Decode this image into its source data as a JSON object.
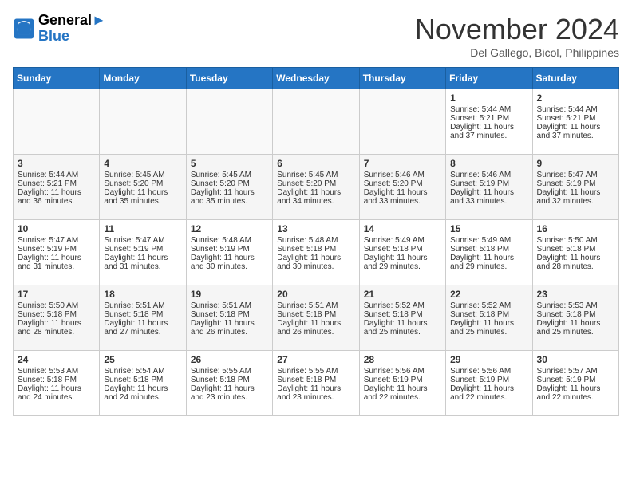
{
  "header": {
    "logo_line1": "General",
    "logo_line2": "Blue",
    "month": "November 2024",
    "location": "Del Gallego, Bicol, Philippines"
  },
  "weekdays": [
    "Sunday",
    "Monday",
    "Tuesday",
    "Wednesday",
    "Thursday",
    "Friday",
    "Saturday"
  ],
  "weeks": [
    [
      {
        "day": "",
        "info": ""
      },
      {
        "day": "",
        "info": ""
      },
      {
        "day": "",
        "info": ""
      },
      {
        "day": "",
        "info": ""
      },
      {
        "day": "",
        "info": ""
      },
      {
        "day": "1",
        "info": "Sunrise: 5:44 AM\nSunset: 5:21 PM\nDaylight: 11 hours\nand 37 minutes."
      },
      {
        "day": "2",
        "info": "Sunrise: 5:44 AM\nSunset: 5:21 PM\nDaylight: 11 hours\nand 37 minutes."
      }
    ],
    [
      {
        "day": "3",
        "info": "Sunrise: 5:44 AM\nSunset: 5:21 PM\nDaylight: 11 hours\nand 36 minutes."
      },
      {
        "day": "4",
        "info": "Sunrise: 5:45 AM\nSunset: 5:20 PM\nDaylight: 11 hours\nand 35 minutes."
      },
      {
        "day": "5",
        "info": "Sunrise: 5:45 AM\nSunset: 5:20 PM\nDaylight: 11 hours\nand 35 minutes."
      },
      {
        "day": "6",
        "info": "Sunrise: 5:45 AM\nSunset: 5:20 PM\nDaylight: 11 hours\nand 34 minutes."
      },
      {
        "day": "7",
        "info": "Sunrise: 5:46 AM\nSunset: 5:20 PM\nDaylight: 11 hours\nand 33 minutes."
      },
      {
        "day": "8",
        "info": "Sunrise: 5:46 AM\nSunset: 5:19 PM\nDaylight: 11 hours\nand 33 minutes."
      },
      {
        "day": "9",
        "info": "Sunrise: 5:47 AM\nSunset: 5:19 PM\nDaylight: 11 hours\nand 32 minutes."
      }
    ],
    [
      {
        "day": "10",
        "info": "Sunrise: 5:47 AM\nSunset: 5:19 PM\nDaylight: 11 hours\nand 31 minutes."
      },
      {
        "day": "11",
        "info": "Sunrise: 5:47 AM\nSunset: 5:19 PM\nDaylight: 11 hours\nand 31 minutes."
      },
      {
        "day": "12",
        "info": "Sunrise: 5:48 AM\nSunset: 5:19 PM\nDaylight: 11 hours\nand 30 minutes."
      },
      {
        "day": "13",
        "info": "Sunrise: 5:48 AM\nSunset: 5:18 PM\nDaylight: 11 hours\nand 30 minutes."
      },
      {
        "day": "14",
        "info": "Sunrise: 5:49 AM\nSunset: 5:18 PM\nDaylight: 11 hours\nand 29 minutes."
      },
      {
        "day": "15",
        "info": "Sunrise: 5:49 AM\nSunset: 5:18 PM\nDaylight: 11 hours\nand 29 minutes."
      },
      {
        "day": "16",
        "info": "Sunrise: 5:50 AM\nSunset: 5:18 PM\nDaylight: 11 hours\nand 28 minutes."
      }
    ],
    [
      {
        "day": "17",
        "info": "Sunrise: 5:50 AM\nSunset: 5:18 PM\nDaylight: 11 hours\nand 28 minutes."
      },
      {
        "day": "18",
        "info": "Sunrise: 5:51 AM\nSunset: 5:18 PM\nDaylight: 11 hours\nand 27 minutes."
      },
      {
        "day": "19",
        "info": "Sunrise: 5:51 AM\nSunset: 5:18 PM\nDaylight: 11 hours\nand 26 minutes."
      },
      {
        "day": "20",
        "info": "Sunrise: 5:51 AM\nSunset: 5:18 PM\nDaylight: 11 hours\nand 26 minutes."
      },
      {
        "day": "21",
        "info": "Sunrise: 5:52 AM\nSunset: 5:18 PM\nDaylight: 11 hours\nand 25 minutes."
      },
      {
        "day": "22",
        "info": "Sunrise: 5:52 AM\nSunset: 5:18 PM\nDaylight: 11 hours\nand 25 minutes."
      },
      {
        "day": "23",
        "info": "Sunrise: 5:53 AM\nSunset: 5:18 PM\nDaylight: 11 hours\nand 25 minutes."
      }
    ],
    [
      {
        "day": "24",
        "info": "Sunrise: 5:53 AM\nSunset: 5:18 PM\nDaylight: 11 hours\nand 24 minutes."
      },
      {
        "day": "25",
        "info": "Sunrise: 5:54 AM\nSunset: 5:18 PM\nDaylight: 11 hours\nand 24 minutes."
      },
      {
        "day": "26",
        "info": "Sunrise: 5:55 AM\nSunset: 5:18 PM\nDaylight: 11 hours\nand 23 minutes."
      },
      {
        "day": "27",
        "info": "Sunrise: 5:55 AM\nSunset: 5:18 PM\nDaylight: 11 hours\nand 23 minutes."
      },
      {
        "day": "28",
        "info": "Sunrise: 5:56 AM\nSunset: 5:19 PM\nDaylight: 11 hours\nand 22 minutes."
      },
      {
        "day": "29",
        "info": "Sunrise: 5:56 AM\nSunset: 5:19 PM\nDaylight: 11 hours\nand 22 minutes."
      },
      {
        "day": "30",
        "info": "Sunrise: 5:57 AM\nSunset: 5:19 PM\nDaylight: 11 hours\nand 22 minutes."
      }
    ]
  ]
}
